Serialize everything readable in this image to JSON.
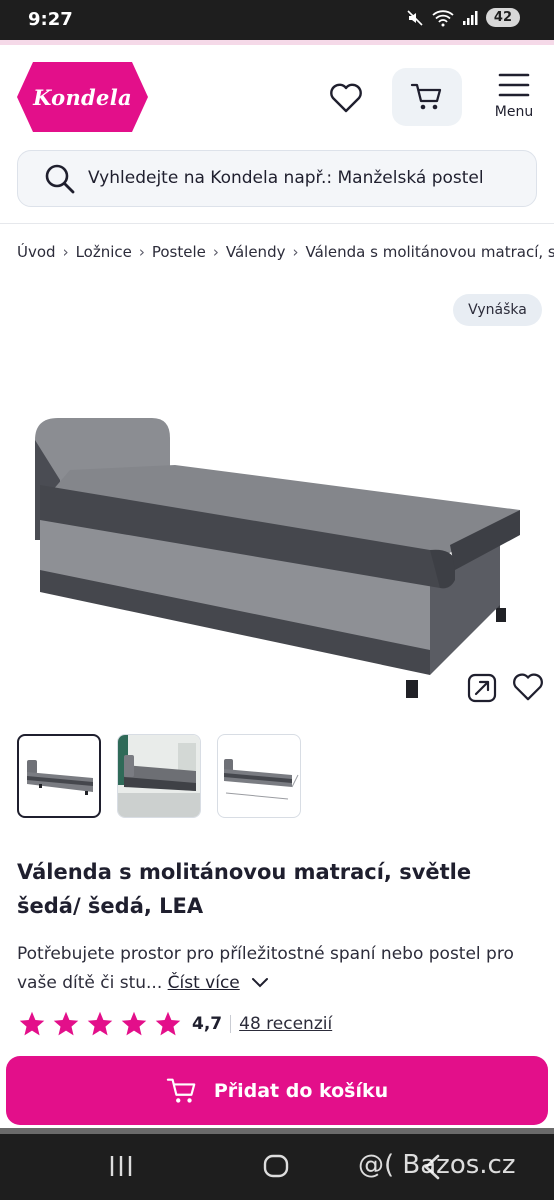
{
  "status_bar": {
    "time": "9:27",
    "battery": "42"
  },
  "header": {
    "logo_text": "Kondela",
    "menu_label": "Menu"
  },
  "search": {
    "placeholder": "Vyhledejte na Kondela např.: Manželská postel"
  },
  "breadcrumb": [
    "Úvod",
    "Ložnice",
    "Postele",
    "Válendy",
    "Válenda s molitánovou matrací, světle šedá/šedá, LEA"
  ],
  "badge": "Vynáška",
  "product": {
    "title": "Válenda s molitánovou matrací, světle šedá/ šedá, LEA",
    "description": "Potřebujete prostor pro příležitostné spaní nebo postel pro vaše dítě či stu...",
    "read_more": "Číst více",
    "rating": "4,7",
    "stars": 5,
    "reviews": "48 recenzií"
  },
  "add_to_cart": "Přidat do košíku",
  "watermark": "@( Bazos.cz",
  "colors": {
    "brand": "#e30f8a",
    "text": "#1f1f2e",
    "cart_bg": "#eef2f6"
  }
}
